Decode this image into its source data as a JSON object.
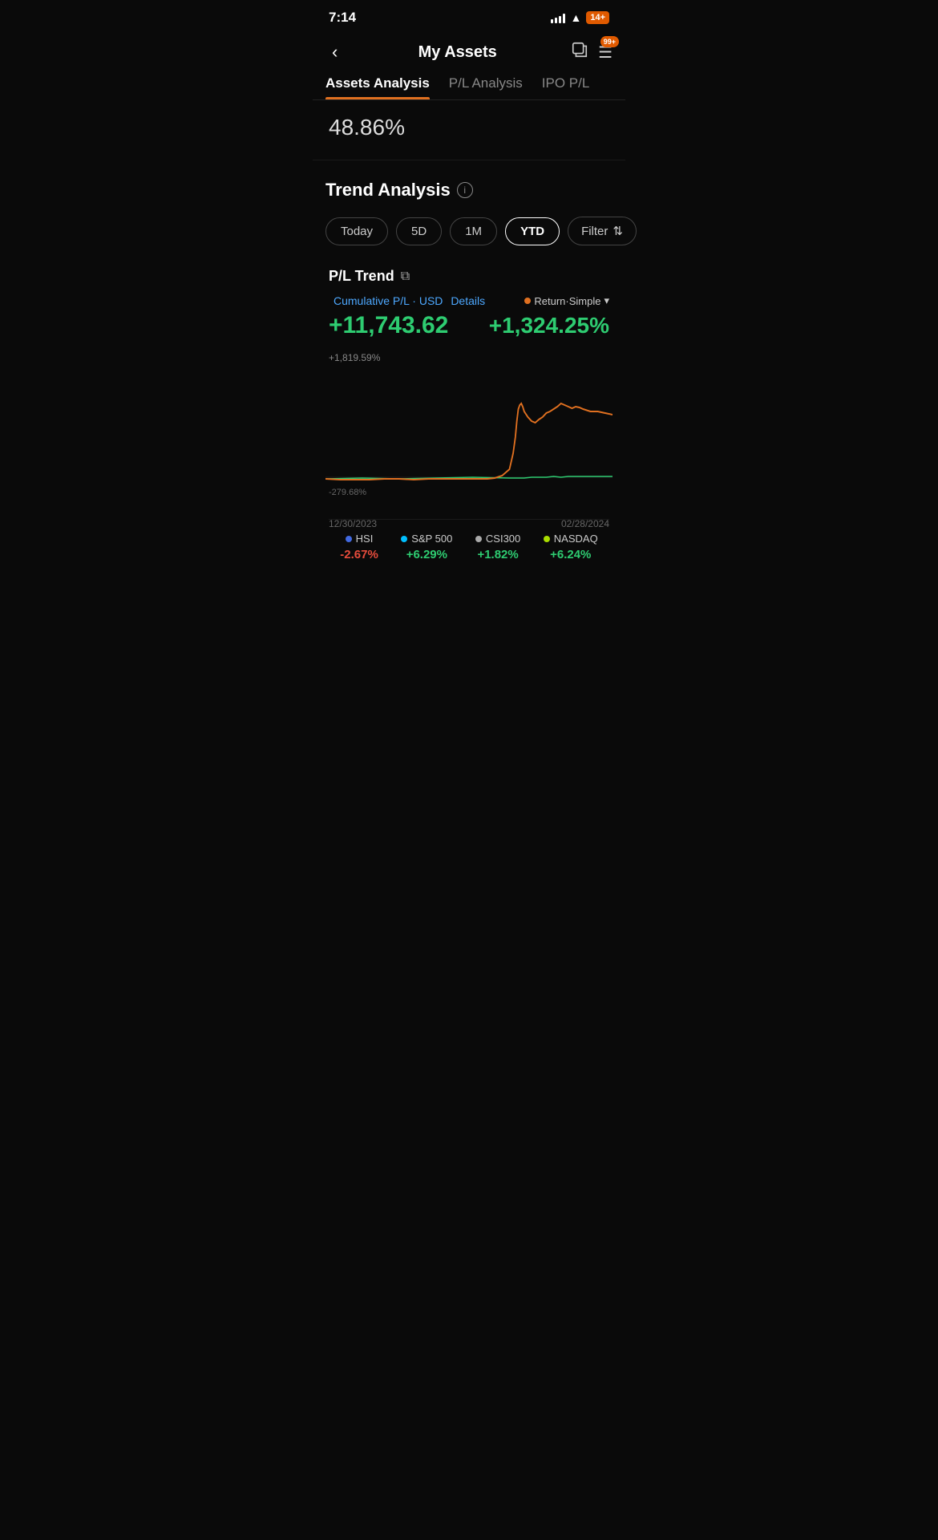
{
  "statusBar": {
    "time": "7:14",
    "battery": "14+"
  },
  "header": {
    "title": "My Assets",
    "notifBadge": "99+",
    "shareLabel": "share",
    "menuLabel": "menu"
  },
  "tabs": [
    {
      "id": "assets",
      "label": "Assets Analysis",
      "active": true
    },
    {
      "id": "pl",
      "label": "P/L Analysis",
      "active": false
    },
    {
      "id": "ipo",
      "label": "IPO P/L",
      "active": false
    }
  ],
  "assetsValue": {
    "percentage": "48.86%"
  },
  "trendSection": {
    "title": "Trend Analysis",
    "infoIcon": "i"
  },
  "periodButtons": [
    {
      "id": "today",
      "label": "Today",
      "active": false
    },
    {
      "id": "5d",
      "label": "5D",
      "active": false
    },
    {
      "id": "1m",
      "label": "1M",
      "active": false
    },
    {
      "id": "ytd",
      "label": "YTD",
      "active": true
    }
  ],
  "filterButton": {
    "label": "Filter"
  },
  "plTrend": {
    "title": "P/L Trend",
    "copyIcon": "⧉",
    "metaLabel": "Cumulative P/L · USD",
    "detailsLink": "Details",
    "returnType": "Return·Simple",
    "cumulativePL": "+11,743.62",
    "returnPct": "+1,324.25%",
    "topLabel": "+1,819.59%",
    "bottomLabel": "-279.68%",
    "dateStart": "12/30/2023",
    "dateEnd": "02/28/2024"
  },
  "legend": [
    {
      "id": "hsi",
      "name": "HSI",
      "dotColor": "#4169e1",
      "value": "-2.67%",
      "valClass": "val-red"
    },
    {
      "id": "sp500",
      "name": "S&P 500",
      "dotColor": "#00bfff",
      "value": "+6.29%",
      "valClass": "val-green"
    },
    {
      "id": "csi300",
      "name": "CSI300",
      "dotColor": "#aaaaaa",
      "value": "+1.82%",
      "valClass": "val-green"
    },
    {
      "id": "nasdaq",
      "name": "NASDAQ",
      "dotColor": "#aadd00",
      "value": "+6.24%",
      "valClass": "val-green"
    }
  ]
}
